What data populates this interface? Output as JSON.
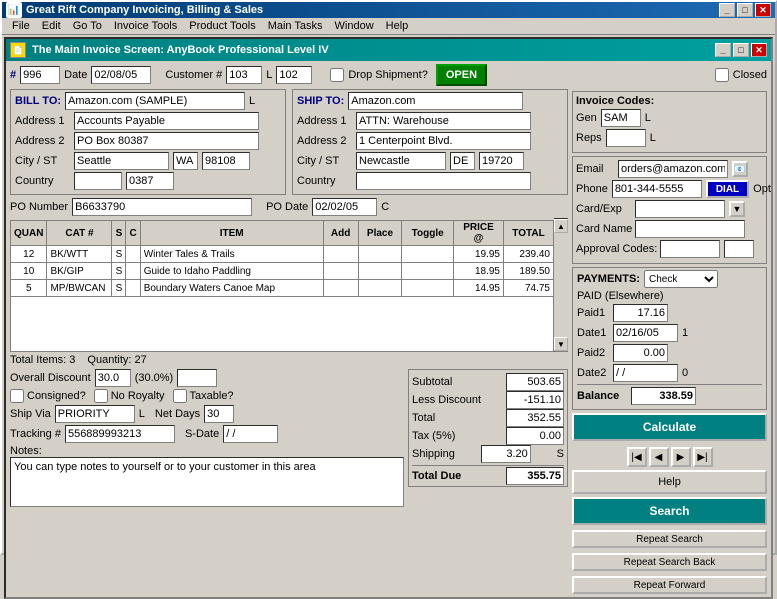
{
  "app": {
    "title": "Great Rift Company Invoicing, Billing & Sales",
    "menu": [
      "File",
      "Edit",
      "Go To",
      "Invoice Tools",
      "Product Tools",
      "Main Tasks",
      "Window",
      "Help"
    ]
  },
  "main_window": {
    "title": "The Main Invoice Screen: AnyBook Professional Level IV"
  },
  "header": {
    "invoice_num_label": "#",
    "invoice_num": "996",
    "date_label": "Date",
    "date": "02/08/05",
    "customer_label": "Customer #",
    "customer_num": "103",
    "customer_code": "L",
    "customer_alt": "102",
    "drop_shipment_label": "Drop Shipment?",
    "open_btn": "OPEN",
    "closed_label": "Closed"
  },
  "bill_to": {
    "label": "BILL TO:",
    "name": "Amazon.com (SAMPLE)",
    "code": "L",
    "address1_label": "Address 1",
    "address1": "Accounts Payable",
    "address2_label": "Address 2",
    "address2": "PO Box 80387",
    "city_st_label": "City / ST",
    "city": "Seattle",
    "state": "WA",
    "zip": "98108",
    "country_label": "Country",
    "country_code": "0387"
  },
  "ship_to": {
    "label": "SHIP TO:",
    "name": "Amazon.com",
    "address1_label": "Address 1",
    "address1": "ATTN: Warehouse",
    "address2_label": "Address 2",
    "address2": "1 Centerpoint Blvd.",
    "city_st_label": "City / ST",
    "city": "Newcastle",
    "state": "DE",
    "zip": "19720",
    "country_label": "Country",
    "country": ""
  },
  "invoice_codes": {
    "label": "Invoice Codes:",
    "gen_label": "Gen",
    "gen_val": "SAM",
    "reps_label": "Reps"
  },
  "po": {
    "number_label": "PO Number",
    "number": "B6633790",
    "date_label": "PO Date",
    "date": "02/02/05",
    "date_code": "C"
  },
  "table": {
    "headers": [
      "QUAN",
      "CAT #",
      "S",
      "C",
      "ITEM",
      "Add",
      "Place",
      "Toggle",
      "PRICE @",
      "TOTAL"
    ],
    "rows": [
      {
        "quan": "12",
        "cat": "BK/WTT",
        "s": "S",
        "c": "",
        "item": "Winter Tales & Trails",
        "price": "19.95",
        "total": "239.40"
      },
      {
        "quan": "10",
        "cat": "BK/GIP",
        "s": "S",
        "c": "",
        "item": "Guide to Idaho Paddling",
        "price": "18.95",
        "total": "189.50"
      },
      {
        "quan": "5",
        "cat": "MP/BWCAN",
        "s": "S",
        "c": "",
        "item": "Boundary Waters Canoe Map",
        "price": "14.95",
        "total": "74.75"
      }
    ],
    "total_items_label": "Total Items: 3",
    "quantity_label": "Quantity: 27"
  },
  "discount": {
    "label": "Overall Discount",
    "value": "30.0",
    "percent": "(30.0%)"
  },
  "checkboxes": {
    "consigned": "Consigned?",
    "no_royalty": "No Royalty",
    "taxable": "Taxable?"
  },
  "ship": {
    "via_label": "Ship Via",
    "via": "PRIORITY",
    "code": "L",
    "net_days_label": "Net Days",
    "net_days": "30"
  },
  "tracking": {
    "label": "Tracking #",
    "value": "556889993213",
    "s_date_label": "S-Date",
    "s_date": "/ /"
  },
  "notes": {
    "label": "Notes:",
    "text": "You can type notes to yourself or to your customer in this area"
  },
  "summary": {
    "subtotal_label": "Subtotal",
    "subtotal": "503.65",
    "less_discount_label": "Less Discount",
    "less_discount": "-151.10",
    "total_label": "Total",
    "total": "352.55",
    "tax_label": "Tax (5%)",
    "tax": "0.00",
    "shipping_label": "Shipping",
    "shipping": "3.20",
    "shipping_code": "S",
    "total_due_label": "Total Due",
    "total_due": "355.75"
  },
  "contact": {
    "email_label": "Email",
    "email": "orders@amazon.com",
    "phone_label": "Phone",
    "phone": "801-344-5555",
    "dial_btn": "DIAL",
    "opt_label": "Opt",
    "card_exp_label": "Card/Exp",
    "card_name_label": "Card Name",
    "approval_label": "Approval Codes:"
  },
  "payments": {
    "label": "PAYMENTS:",
    "method": "Check",
    "paid_elsewhere_label": "PAID (Elsewhere)",
    "paid1_label": "Paid1",
    "paid1": "17.16",
    "date1_label": "Date1",
    "date1": "02/16/05",
    "date1_code": "1",
    "paid2_label": "Paid2",
    "paid2": "0.00",
    "date2_label": "Date2",
    "date2": "/ /",
    "date2_code": "0",
    "balance_label": "Balance",
    "balance": "338.59"
  },
  "buttons": {
    "calculate": "Calculate",
    "help": "Help",
    "search": "Search",
    "repeat_search": "Repeat Search",
    "repeat_search_back": "Repeat Search Back",
    "repeat_forward": "Repeat Forward"
  }
}
